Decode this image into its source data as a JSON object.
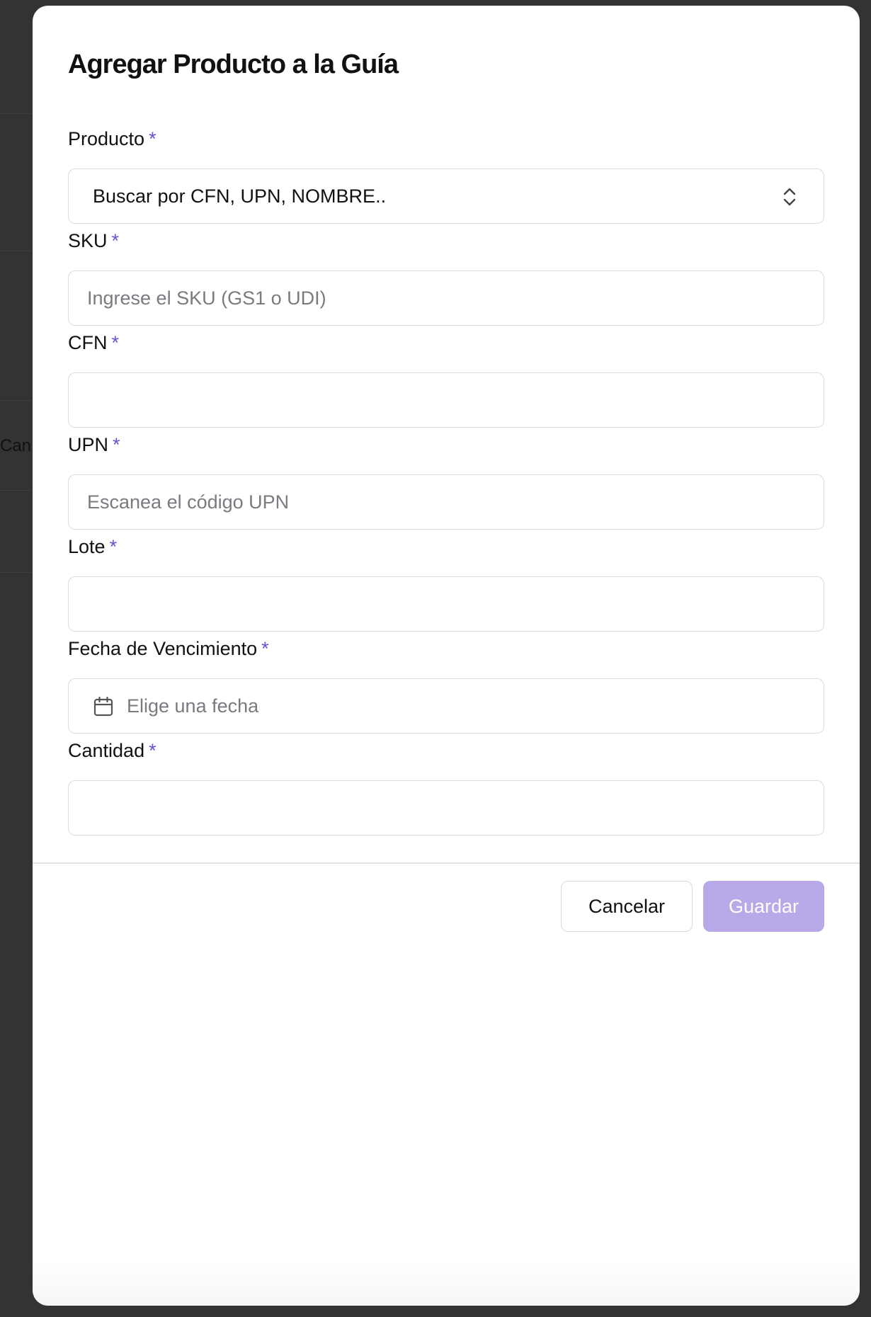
{
  "background": {
    "partial_text": "Can"
  },
  "modal": {
    "title": "Agregar Producto a la Guía",
    "required_mark": "*",
    "fields": {
      "producto": {
        "label": "Producto",
        "value": "Buscar por CFN, UPN, NOMBRE..",
        "icon": "chevron-up-down-icon"
      },
      "sku": {
        "label": "SKU",
        "value": "",
        "placeholder": "Ingrese el SKU (GS1 o UDI)"
      },
      "cfn": {
        "label": "CFN",
        "value": "",
        "placeholder": ""
      },
      "upn": {
        "label": "UPN",
        "value": "",
        "placeholder": "Escanea el código UPN"
      },
      "lote": {
        "label": "Lote",
        "value": "",
        "placeholder": ""
      },
      "fecha_vencimiento": {
        "label": "Fecha de Vencimiento",
        "value": "",
        "placeholder": "Elige una fecha",
        "icon": "calendar-icon"
      },
      "cantidad": {
        "label": "Cantidad",
        "value": "",
        "placeholder": ""
      }
    },
    "buttons": {
      "cancel_label": "Cancelar",
      "save_label": "Guardar"
    }
  },
  "colors": {
    "accent": "#6d4fd1",
    "save_button_disabled": "#b9a9e8",
    "overlay": "#333334"
  }
}
